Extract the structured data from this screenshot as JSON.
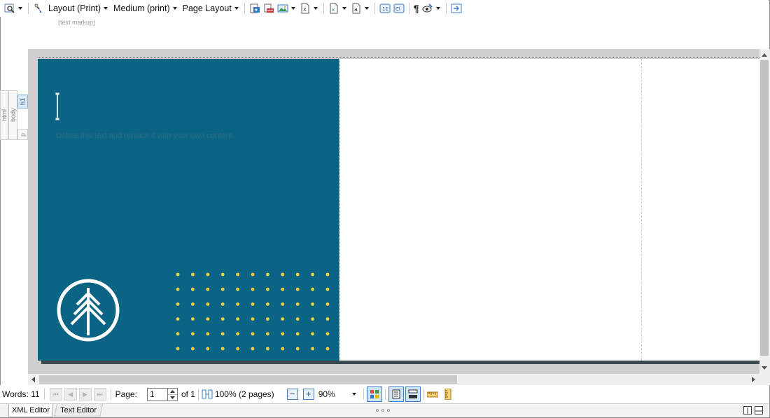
{
  "toolbar": {
    "layout_label": "Layout (Print)",
    "medium_label": "Medium (print)",
    "page_layout_label": "Page Layout",
    "hint": "(text markup)",
    "icons": [
      "preview-icon",
      "tag-icon",
      "insert-image-icon",
      "insert-link-icon",
      "picture-icon",
      "xml-file-icon",
      "excel-icon",
      "text-box-icon",
      "h1-icon",
      "cl-icon",
      "pilcrow-icon",
      "inspect-icon",
      "export-icon"
    ]
  },
  "tagbar": {
    "html": "html",
    "body": "body",
    "h1": "h1",
    "p": "p"
  },
  "document": {
    "body_text": "Delete this text and replace it with your own content.",
    "panel_color": "#0b6483",
    "dot_color": "#f2cf3a",
    "dot_rows": 6,
    "dot_cols": 11
  },
  "status": {
    "words_label": "Words: 11",
    "page_label": "Page:",
    "page_value": "1",
    "of_label": "of 1",
    "fit_label": "100% (2 pages)",
    "zoom_value": "90%"
  },
  "tabs": {
    "xml": "XML Editor",
    "text": "Text Editor"
  }
}
